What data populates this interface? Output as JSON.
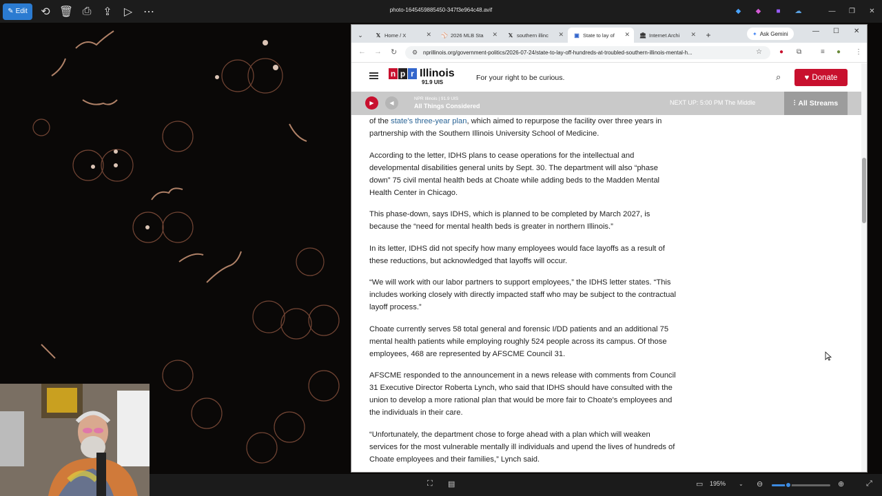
{
  "viewer": {
    "title": "photo-1645459885450-347f3e964c48.avif",
    "edit_label": "Edit",
    "zoom": "195%",
    "zoom_fraction": 0.28
  },
  "browser": {
    "tabs": [
      {
        "label": "Home / X",
        "icon": "x-logo-icon",
        "active": false
      },
      {
        "label": "2026 MLB Sta",
        "icon": "mlb-logo-icon",
        "active": false
      },
      {
        "label": "southern illinc",
        "icon": "x-logo-icon",
        "active": false
      },
      {
        "label": "State to lay of",
        "icon": "npr-logo-icon",
        "active": true
      },
      {
        "label": "Internet Archi",
        "icon": "archive-icon",
        "active": false
      }
    ],
    "gemini_label": "Ask Gemini",
    "url": "nprillinois.org/government-politics/2026-07-24/state-to-lay-off-hundreds-at-troubled-southern-illinois-mental-h..."
  },
  "site": {
    "logo_letters": [
      "n",
      "p",
      "r"
    ],
    "logo_name": "Illinois",
    "logo_freq": "91.9 UIS",
    "tagline": "For your right to be curious.",
    "donate_label": "Donate"
  },
  "player": {
    "station": "NPR Illinois | 91.9 UIS",
    "program": "All Things Considered",
    "next_up_label": "NEXT UP:",
    "next_up_time": "5:00 PM",
    "next_up_show": "The Middle",
    "all_streams_label": "All Streams"
  },
  "article": {
    "p0_pre": "of the ",
    "p0_link": "state's three-year plan",
    "p0_post": ", which aimed to repurpose the facility over three years in partnership with the Southern Illinois University School of Medicine.",
    "paragraphs": [
      "According to the letter, IDHS plans to cease operations for the intellectual and developmental disabilities general units by Sept. 30. The department will also “phase down” 75 civil mental health beds at Choate while adding beds to the Madden Mental Health Center in Chicago.",
      "This phase-down, says IDHS, which is planned to be completed by March 2027, is because the “need for mental health beds is greater in northern Illinois.”",
      "In its letter, IDHS did not specify how many employees would face layoffs as a result of these reductions, but acknowledged that layoffs will occur.",
      "“We will work with our labor partners to support employees,” the IDHS letter states. “This includes working closely with directly impacted staff who may be subject to the contractual layoff process.”",
      "Choate currently serves 58 total general and forensic I/DD patients and an additional 75 mental health patients while employing roughly 524 people across its campus. Of those employees, 468 are represented by AFSCME Council 31.",
      "AFSCME responded to the announcement in a news release with comments from Council 31 Executive Director Roberta Lynch, who said that IDHS should have consulted with the union to develop a more rational plan that would be more fair to Choate's employees and the individuals in their care.",
      "“Unfortunately, the department chose to forge ahead with a plan which will weaken services for the most vulnerable mentally ill individuals and upend the lives of hundreds of Choate employees and their families,” Lynch said."
    ]
  },
  "colors": {
    "npr_red": "#c8102e",
    "npr_black": "#231f20",
    "npr_blue": "#3366cc",
    "link": "#2a6496",
    "viewer_accent": "#2b7bd1"
  }
}
